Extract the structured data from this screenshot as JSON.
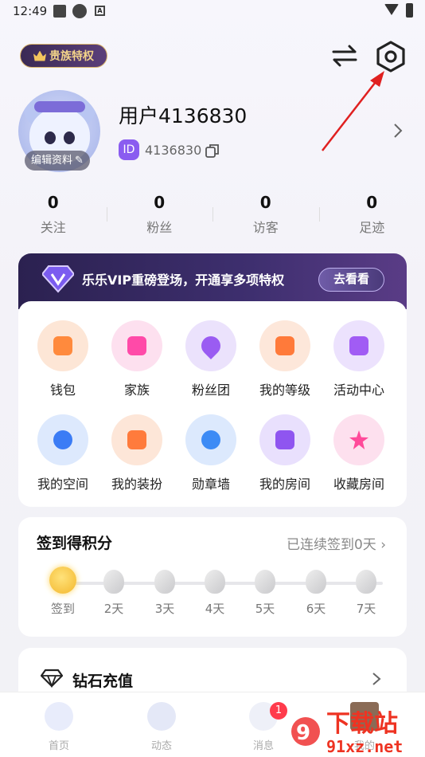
{
  "status_bar": {
    "time": "12:49",
    "notif_icon_label": "A"
  },
  "header": {
    "noble_badge": "贵族特权"
  },
  "profile": {
    "username": "用户4136830",
    "id_label": "ID",
    "id_value": "4136830",
    "edit_label": "编辑资料"
  },
  "stats": [
    {
      "count": "0",
      "label": "关注"
    },
    {
      "count": "0",
      "label": "粉丝"
    },
    {
      "count": "0",
      "label": "访客"
    },
    {
      "count": "0",
      "label": "足迹"
    }
  ],
  "vip_banner": {
    "text": "乐乐VIP重磅登场，开通享多项特权",
    "button": "去看看"
  },
  "features": [
    {
      "label": "钱包",
      "icon": "wallet-icon",
      "color": "#ff8a3d",
      "bg": "#fde6d6"
    },
    {
      "label": "家族",
      "icon": "family-icon",
      "color": "#ff4aa8",
      "bg": "#fde0ef"
    },
    {
      "label": "粉丝团",
      "icon": "fan-club-icon",
      "color": "#9a5cf2",
      "bg": "#ebe2fc"
    },
    {
      "label": "我的等级",
      "icon": "level-icon",
      "color": "#ff7a3a",
      "bg": "#fde7da"
    },
    {
      "label": "活动中心",
      "icon": "gift-icon",
      "color": "#a15cf4",
      "bg": "#ece2fd"
    },
    {
      "label": "我的空间",
      "icon": "planet-icon",
      "color": "#3b7cf5",
      "bg": "#dde9fd"
    },
    {
      "label": "我的装扮",
      "icon": "outfit-icon",
      "color": "#ff7b3c",
      "bg": "#fde6d8"
    },
    {
      "label": "勋章墙",
      "icon": "medal-icon",
      "color": "#3d8bf5",
      "bg": "#dce9fd"
    },
    {
      "label": "我的房间",
      "icon": "room-icon",
      "color": "#8f55f0",
      "bg": "#e9e0fd"
    },
    {
      "label": "收藏房间",
      "icon": "star-icon",
      "color": "#ff4a9a",
      "bg": "#fde0ee"
    }
  ],
  "signin": {
    "title": "签到得积分",
    "status": "已连续签到0天",
    "days": [
      "签到",
      "2天",
      "3天",
      "4天",
      "5天",
      "6天",
      "7天"
    ]
  },
  "diamond": {
    "label": "钻石充值"
  },
  "tabbar": {
    "tabs": [
      {
        "label": "首页"
      },
      {
        "label": "动态"
      },
      {
        "label": "消息",
        "badge": "1"
      },
      {
        "label": "我的"
      }
    ]
  },
  "watermark": {
    "text": "下载站",
    "url": "91xz.net"
  }
}
